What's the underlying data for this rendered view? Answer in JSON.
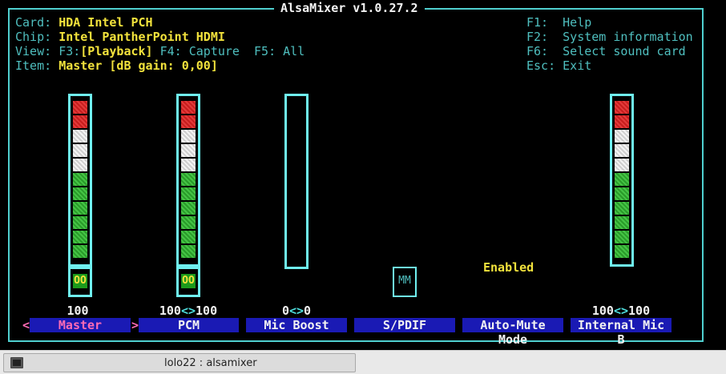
{
  "window_title": "AlsaMixer v1.0.27.2",
  "header": {
    "card_label": "Card:",
    "card_value": "HDA Intel PCH",
    "chip_label": "Chip:",
    "chip_value": "Intel PantherPoint HDMI",
    "view_label": "View:",
    "view_f3": "F3:",
    "view_playback": "[Playback]",
    "view_f4": "F4:",
    "view_capture": "Capture",
    "view_f5": "F5:",
    "view_all": "All",
    "item_label": "Item:",
    "item_value": "Master [dB gain: 0,00]"
  },
  "help": {
    "f1_key": "F1:",
    "f1_text": "Help",
    "f2_key": "F2:",
    "f2_text": "System information",
    "f6_key": "F6:",
    "f6_text": "Select sound card",
    "esc_key": "Esc:",
    "esc_text": "Exit"
  },
  "controls": [
    {
      "name": "Master",
      "value_text": "100",
      "switch": "OO",
      "level": 1.0,
      "selected": true
    },
    {
      "name": "PCM",
      "value_left": "100",
      "value_arrows": "<>",
      "value_right": "100",
      "switch": "OO",
      "level": 1.0
    },
    {
      "name": "Mic Boost",
      "value_left": "0",
      "value_arrows": "<>",
      "value_right": "0",
      "level": 0.0
    },
    {
      "name": "S/PDIF",
      "switch": "MM"
    },
    {
      "name": "Auto-Mute Mode",
      "state": "Enabled"
    },
    {
      "name": "Internal Mic B",
      "value_left": "100",
      "value_arrows": "<>",
      "value_right": "100",
      "level": 1.0
    }
  ],
  "nav_marks": {
    "left": "<",
    "sep": ">"
  },
  "taskbar": {
    "label": "lolo22 : alsamixer"
  },
  "colors": {
    "border": "#4fcfcf",
    "channel_bg": "#1a1ab4",
    "highlight": "#f2e23c",
    "selected": "#ff6bb5"
  }
}
